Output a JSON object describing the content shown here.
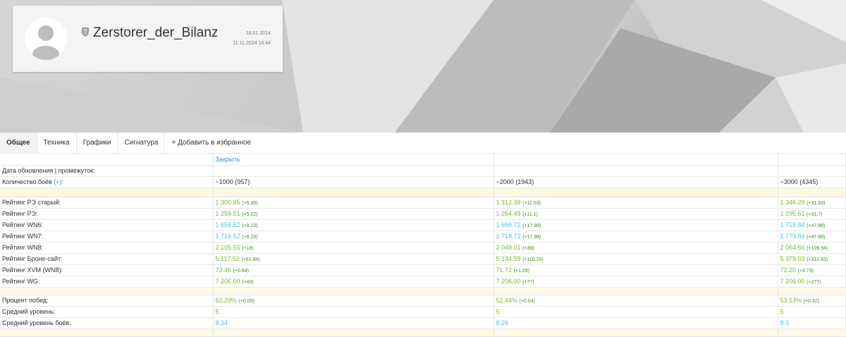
{
  "profile": {
    "name": "Zerstorer_der_Bilanz",
    "registered": "18.01.2014",
    "updated": "11.11.2024 18:44"
  },
  "tabs": [
    "Общее",
    "Техника",
    "Графики",
    "Сигнатура",
    "+ Добавить в избранное"
  ],
  "table": {
    "close_label": "Закрыть",
    "update_label": "Дата обновления | промежуток:",
    "battles_label": "Количество боёв ",
    "battles_plus": "(+)",
    "battles_colon": ":",
    "battles": [
      "~1000 (957)",
      "~2000 (1943)",
      "~3000 (4345)"
    ],
    "ratings": [
      {
        "label": "Рейтинг РЭ старый:",
        "color": "g",
        "cells": [
          [
            "1 300.95",
            "(+5.35)"
          ],
          [
            "1 312.39",
            "(+11.53)"
          ],
          [
            "1 346.28",
            "(+31.83)"
          ]
        ]
      },
      {
        "label": "Рейтинг РЭ:",
        "color": "g",
        "cells": [
          [
            "1 259.51",
            "(+5.22)"
          ],
          [
            "1 264.49",
            "(+11.1)"
          ],
          [
            "1 295.61",
            "(+31.7)"
          ]
        ]
      },
      {
        "label": "Рейтинг WN6:",
        "color": "b",
        "cells": [
          [
            "1 656.52",
            "(+9.23)"
          ],
          [
            "1 658.72",
            "(+17.98)"
          ],
          [
            "1 719.84",
            "(+47.88)"
          ]
        ]
      },
      {
        "label": "Рейтинг WN7:",
        "color": "b",
        "cells": [
          [
            "1 716.52",
            "(+9.23)"
          ],
          [
            "1 718.72",
            "(+17.98)"
          ],
          [
            "1 779.84",
            "(+47.88)"
          ]
        ]
      },
      {
        "label": "Рейтинг WN8:",
        "color": "g",
        "cells": [
          [
            "2 105.55",
            "(+19)"
          ],
          [
            "2 049.01",
            "(+38)"
          ],
          [
            "2 064.66",
            "(+109.94)"
          ]
        ]
      },
      {
        "label": "Рейтинг Броне-сайт:",
        "color": "g",
        "cells": [
          [
            "5 117.52",
            "(+51.94)"
          ],
          [
            "5 134.59",
            "(+110.25)"
          ],
          [
            "5 379.03",
            "(+312.63)"
          ]
        ]
      },
      {
        "label": "Рейтинг XVM (WN8):",
        "color": "g",
        "cells": [
          [
            "73.46",
            "(+0.64)"
          ],
          [
            "71.72",
            "(+1.29)"
          ],
          [
            "72.20",
            "(+3.73)"
          ]
        ]
      },
      {
        "label": "Рейтинг WG:",
        "color": "g",
        "cells": [
          [
            "7 206.00",
            "(+43)"
          ],
          [
            "7 206.00",
            "(+77)"
          ],
          [
            "7 206.00",
            "(+277)"
          ]
        ]
      }
    ],
    "stats": [
      {
        "label": "Процент побед:",
        "color": "g",
        "cells": [
          [
            "53.29%",
            "(+0.05)"
          ],
          [
            "52.44%",
            "(+0.04)"
          ],
          [
            "53.53%",
            "(+0.32)"
          ]
        ]
      },
      {
        "label": "Средний уровень:",
        "color": "g",
        "cells": [
          [
            "5",
            ""
          ],
          [
            "5",
            ""
          ],
          [
            "5",
            ""
          ]
        ]
      },
      {
        "label": "Средний уровень боёв:",
        "color": "b",
        "cells": [
          [
            "8.34",
            ""
          ],
          [
            "8.26",
            ""
          ],
          [
            "8.3",
            ""
          ]
        ]
      }
    ]
  },
  "colors": {
    "green": "#7cb82f",
    "blue": "#4fc1e9",
    "separator": "#fcf8e5",
    "link": "#3a8fd9"
  }
}
